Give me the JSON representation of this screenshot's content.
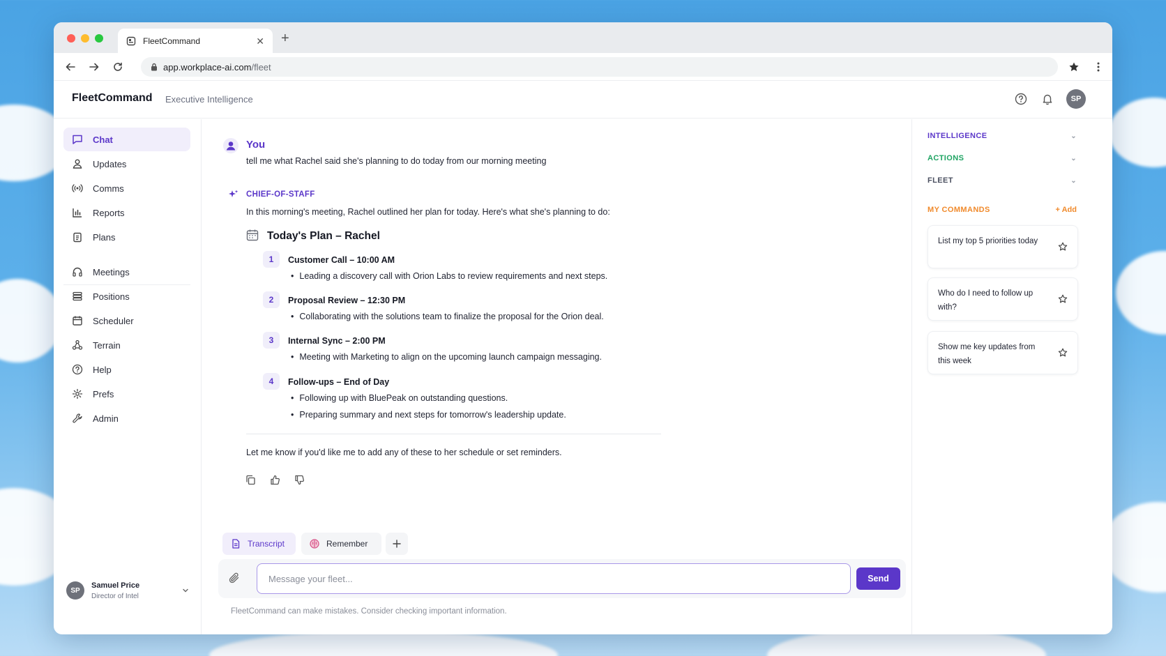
{
  "browser": {
    "tab_title": "FleetCommand",
    "url_host": "app.workplace-ai.com",
    "url_path": "/fleet"
  },
  "header": {
    "brand": "FleetCommand",
    "subtitle": "Executive Intelligence",
    "avatar_initials": "SP"
  },
  "sidebar": {
    "items": [
      {
        "label": "Chat",
        "icon": "chat-icon",
        "active": true
      },
      {
        "label": "Updates",
        "icon": "person-icon"
      },
      {
        "label": "Comms",
        "icon": "broadcast-icon"
      },
      {
        "label": "Reports",
        "icon": "bar-chart-icon"
      },
      {
        "label": "Plans",
        "icon": "clipboard-icon"
      },
      {
        "label": "Meetings",
        "icon": "headphones-icon"
      },
      {
        "label": "Positions",
        "icon": "layers-icon"
      },
      {
        "label": "Scheduler",
        "icon": "calendar-icon"
      },
      {
        "label": "Terrain",
        "icon": "nodes-icon"
      },
      {
        "label": "Help",
        "icon": "help-circle-icon"
      },
      {
        "label": "Prefs",
        "icon": "settings-icon"
      },
      {
        "label": "Admin",
        "icon": "wrench-icon"
      }
    ],
    "user": {
      "initials": "SP",
      "name": "Samuel Price",
      "role": "Director of Intel"
    }
  },
  "chat": {
    "user_label": "You",
    "user_message": "tell me what Rachel said she's planning to do today from our morning meeting",
    "assistant_label": "CHIEF-OF-STAFF",
    "assistant_intro": "In this morning's meeting, Rachel outlined her plan for today. Here's what she's planning to do:",
    "plan_title": "Today's Plan – Rachel",
    "steps": [
      {
        "num": "1",
        "title": "Customer Call – 10:00 AM",
        "bullets": [
          "Leading a discovery call with Orion Labs to review requirements and next steps."
        ]
      },
      {
        "num": "2",
        "title": "Proposal Review – 12:30 PM",
        "bullets": [
          "Collaborating with the solutions team to finalize the proposal for the Orion deal."
        ]
      },
      {
        "num": "3",
        "title": "Internal Sync – 2:00 PM",
        "bullets": [
          "Meeting with Marketing to align on the upcoming launch campaign messaging."
        ]
      },
      {
        "num": "4",
        "title": "Follow-ups – End of Day",
        "bullets": [
          "Following up with BluePeak on outstanding questions.",
          "Preparing summary and next steps for tomorrow's leadership update."
        ]
      }
    ],
    "followup": "Let me know if you'd like me to add any of these to her schedule or set reminders."
  },
  "composer": {
    "chip_transcript": "Transcript",
    "chip_remember": "Remember",
    "placeholder": "Message your fleet...",
    "value": "",
    "send_label": "Send",
    "disclaimer": "FleetCommand can make mistakes. Consider checking important information."
  },
  "right_panel": {
    "sections": [
      {
        "label": "INTELLIGENCE",
        "color": "#5b37c9"
      },
      {
        "label": "ACTIONS",
        "color": "#1fa463"
      },
      {
        "label": "FLEET",
        "color": "#4b5060"
      }
    ],
    "my_commands_label": "MY COMMANDS",
    "my_commands_color": "#f08a2c",
    "add_label": "+ Add",
    "commands": [
      "List my top 5 priorities today",
      "Who do I need to follow up with?",
      "Show me key updates from this week"
    ]
  },
  "colors": {
    "accent": "#5b37c9",
    "accent_soft": "#f1eefb",
    "actions_green": "#1fa463",
    "commands_orange": "#f08a2c"
  }
}
